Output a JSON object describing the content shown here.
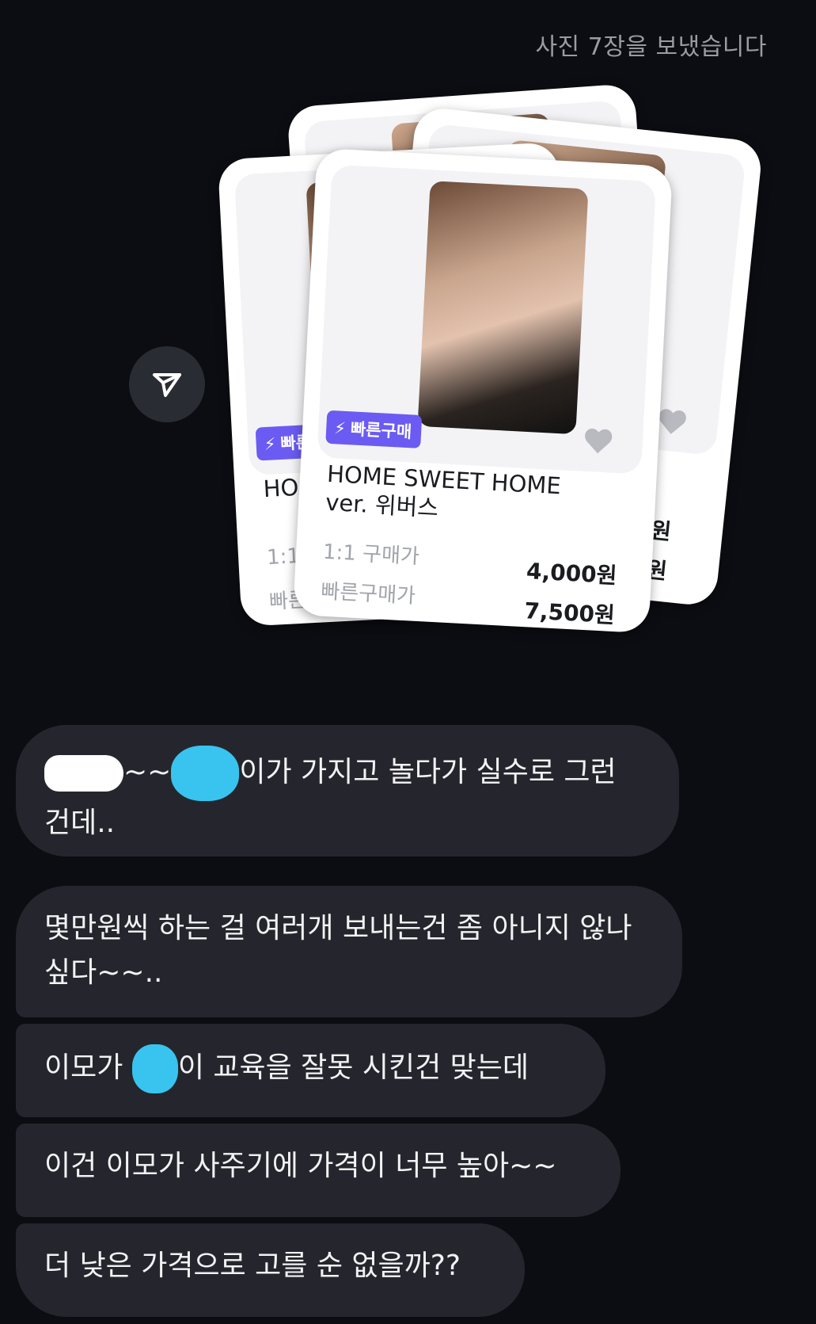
{
  "header": {
    "status_text": "사진 7장을 보냈습니다"
  },
  "share": {
    "icon": "send-icon"
  },
  "cards": {
    "front": {
      "badge": "빠른구매",
      "title_line1": "HOME SWEET HOME",
      "title_line2": "ver. 위버스",
      "label_1to1": "1:1 구매가",
      "price_1to1": "4,000원",
      "label_fast": "빠른구매가",
      "price_fast": "7,500원"
    },
    "back_left": {
      "badge": "빠른",
      "title_partial": "HON",
      "label_1to1_partial": "1:1",
      "label_fast_partial": "빠른"
    },
    "back_right": {
      "price_1_partial": "0원",
      "price_2_partial": "0원"
    }
  },
  "messages": [
    {
      "before_redact": "",
      "middle": "~~",
      "after": "이가 가지고 놀다가 실수로 그런",
      "line2": "건데.."
    },
    {
      "text": "몇만원씩 하는 걸 여러개 보내는건 좀 아니지 않나 싶다~~.."
    },
    {
      "before": "이모가 ",
      "after": "이 교육을 잘못 시킨건 맞는데"
    },
    {
      "text": "이건 이모가 사주기에 가격이 너무 높아~~"
    },
    {
      "text": "더 낮은 가격으로 고를 순 없을까??"
    }
  ],
  "colors": {
    "background": "#0c0d12",
    "bubble": "#25262d",
    "badge": "#6b5bf2",
    "redaction_cyan": "#38c4ee"
  }
}
